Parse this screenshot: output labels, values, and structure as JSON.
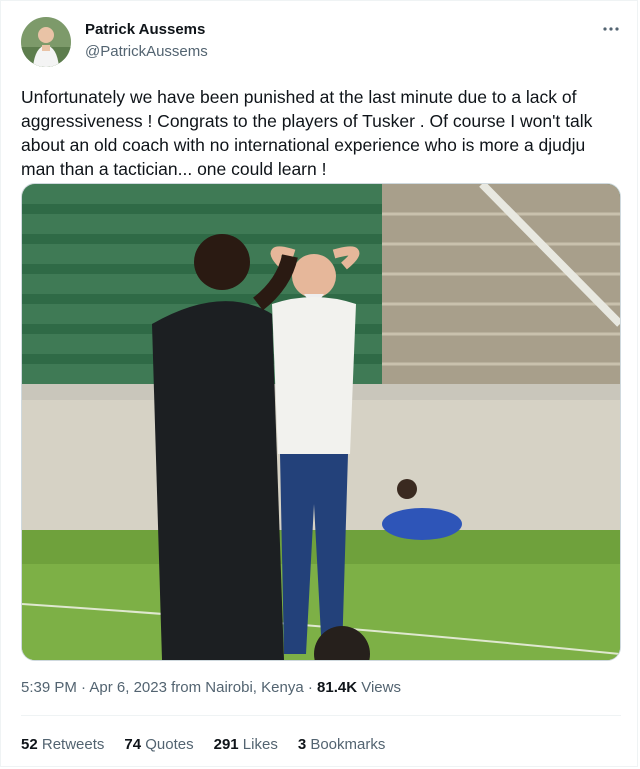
{
  "author": {
    "name": "Patrick Aussems",
    "handle": "@PatrickAussems"
  },
  "tweet": {
    "text": "Unfortunately we have been punished at the last minute due to a lack of aggressiveness ! Congrats to the players of Tusker . Of course I won't talk about an old coach with no international experience who is more a djudju man than a tactician... one could learn !"
  },
  "meta": {
    "time": "5:39 PM",
    "dot1": " · ",
    "date": "Apr 6, 2023",
    "source": " from Nairobi, Kenya",
    "dot2": " · ",
    "views_count": "81.4K",
    "views_label": " Views"
  },
  "stats": {
    "retweets_count": "52",
    "retweets_label": " Retweets",
    "quotes_count": "74",
    "quotes_label": " Quotes",
    "likes_count": "291",
    "likes_label": " Likes",
    "bookmarks_count": "3",
    "bookmarks_label": " Bookmarks"
  },
  "icons": {
    "more": "more-options-icon"
  },
  "colors": {
    "text": "#0f1419",
    "secondary": "#536471",
    "border": "#eff3f4"
  }
}
